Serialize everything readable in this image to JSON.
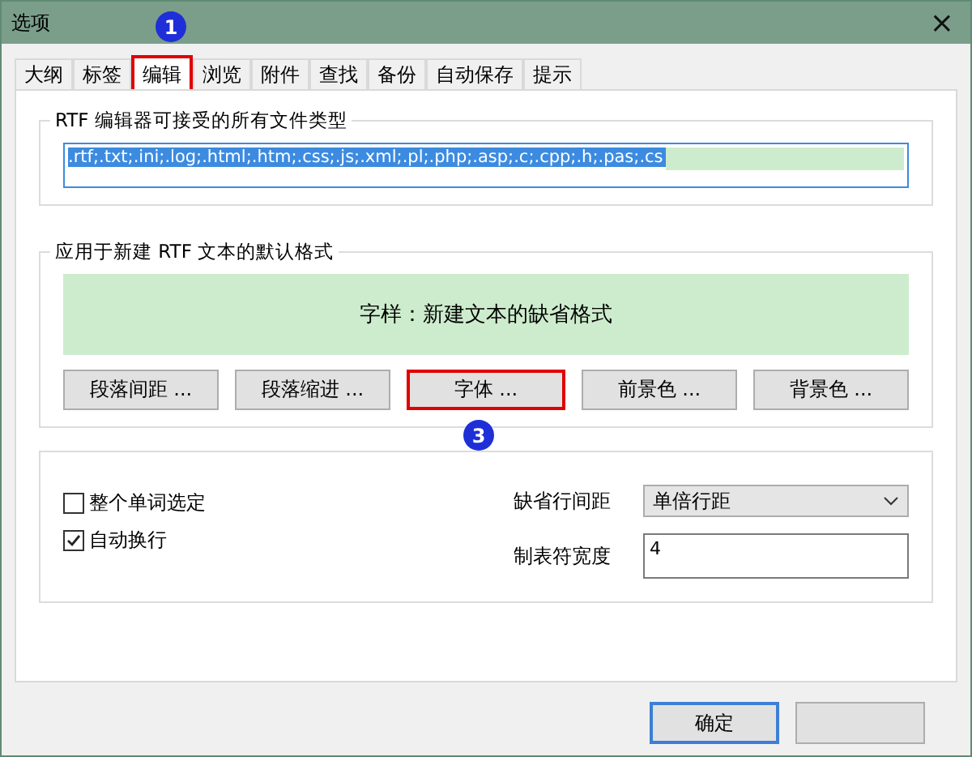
{
  "window": {
    "title": "选项",
    "close": "×"
  },
  "tabs": [
    {
      "label": "大纲",
      "selected": false,
      "highlighted": false
    },
    {
      "label": "标签",
      "selected": false,
      "highlighted": false
    },
    {
      "label": "编辑",
      "selected": true,
      "highlighted": true
    },
    {
      "label": "浏览",
      "selected": false,
      "highlighted": false
    },
    {
      "label": "附件",
      "selected": false,
      "highlighted": false
    },
    {
      "label": "查找",
      "selected": false,
      "highlighted": false
    },
    {
      "label": "备份",
      "selected": false,
      "highlighted": false
    },
    {
      "label": "自动保存",
      "selected": false,
      "highlighted": false
    },
    {
      "label": "提示",
      "selected": false,
      "highlighted": false
    }
  ],
  "markers": [
    {
      "text": "1"
    },
    {
      "text": "3"
    }
  ],
  "file_types": {
    "title": "RTF 编辑器可接受的所有文件类型",
    "value": ".rtf;.txt;.ini;.log;.html;.htm;.css;.js;.xml;.pl;.php;.asp;.c;.cpp;.h;.pas;.cs"
  },
  "default_format": {
    "title": "应用于新建 RTF 文本的默认格式",
    "preview": "字样：新建文本的缺省格式",
    "buttons": [
      {
        "label": "段落间距 ...",
        "highlighted": false
      },
      {
        "label": "段落缩进 ...",
        "highlighted": false
      },
      {
        "label": "字体 ...",
        "highlighted": true
      },
      {
        "label": "前景色 ...",
        "highlighted": false
      },
      {
        "label": "背景色 ...",
        "highlighted": false
      }
    ]
  },
  "options": {
    "checkboxes": [
      {
        "label": "整个单词选定",
        "checked": false
      },
      {
        "label": "自动换行",
        "checked": true
      }
    ],
    "line_spacing": {
      "label": "缺省行间距",
      "value": "单倍行距"
    },
    "tab_width": {
      "label": "制表符宽度",
      "value": "4"
    }
  },
  "footer": {
    "buttons": [
      {
        "label": "确定",
        "default": true
      },
      {
        "default": false
      }
    ]
  }
}
